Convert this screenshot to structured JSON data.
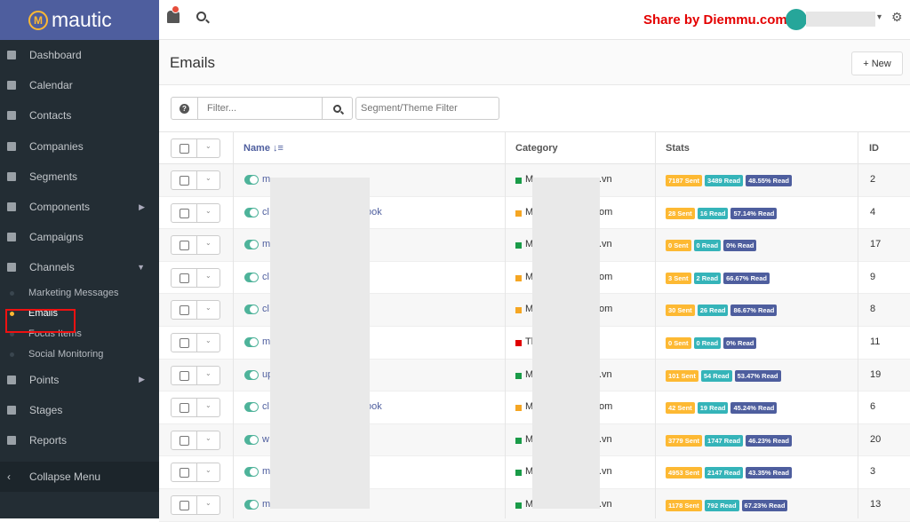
{
  "brand": {
    "name": "mautic",
    "mark": "M"
  },
  "topbar": {
    "share_text": "Share by Diemmu.com",
    "caret": "▾",
    "gear": "⚙"
  },
  "sidebar": {
    "items": [
      {
        "label": "Dashboard"
      },
      {
        "label": "Calendar"
      },
      {
        "label": "Contacts"
      },
      {
        "label": "Companies"
      },
      {
        "label": "Segments"
      },
      {
        "label": "Components",
        "arrow": "▶"
      },
      {
        "label": "Campaigns"
      },
      {
        "label": "Channels",
        "arrow": "▼"
      }
    ],
    "sub_items": [
      {
        "label": "Marketing Messages"
      },
      {
        "label": "Emails"
      },
      {
        "label": "Focus Items"
      },
      {
        "label": "Social Monitoring"
      }
    ],
    "items2": [
      {
        "label": "Points",
        "arrow": "▶"
      },
      {
        "label": "Stages"
      },
      {
        "label": "Reports"
      }
    ],
    "collapse": {
      "label": "Collapse Menu",
      "icon": "‹"
    }
  },
  "header": {
    "title": "Emails",
    "new_label": "+ New"
  },
  "filters": {
    "help_icon": "?",
    "filter_placeholder": "Filter...",
    "segment_placeholder": "Segment/Theme Filter"
  },
  "table": {
    "headers": {
      "name": "Name ↓≡",
      "category": "Category",
      "stats": "Stats",
      "id": "ID"
    },
    "caret": "⌄",
    "rows": [
      {
        "n1": "m",
        "n2": "",
        "c1": "M",
        "c2": ".vn",
        "color": "#1a9b48",
        "sent": "7187 Sent",
        "read": "3489 Read",
        "pct": "48.55% Read",
        "id": "2"
      },
      {
        "n1": "cl",
        "n2": "ook",
        "c1": "M",
        "c2": "om",
        "color": "#f5a623",
        "sent": "28 Sent",
        "read": "16 Read",
        "pct": "57.14% Read",
        "id": "4"
      },
      {
        "n1": "m",
        "n2": "",
        "c1": "M",
        "c2": ".vn",
        "color": "#1a9b48",
        "sent": "0 Sent",
        "read": "0 Read",
        "pct": "0% Read",
        "id": "17"
      },
      {
        "n1": "cl",
        "n2": "",
        "c1": "M",
        "c2": "om",
        "color": "#f5a623",
        "sent": "3 Sent",
        "read": "2 Read",
        "pct": "66.67% Read",
        "id": "9"
      },
      {
        "n1": "cl",
        "n2": "",
        "c1": "M",
        "c2": "om",
        "color": "#f5a623",
        "sent": "30 Sent",
        "read": "26 Read",
        "pct": "86.67% Read",
        "id": "8"
      },
      {
        "n1": "m",
        "n2": "",
        "c1": "Tl",
        "c2": "",
        "color": "#e00000",
        "sent": "0 Sent",
        "read": "0 Read",
        "pct": "0% Read",
        "id": "11"
      },
      {
        "n1": "up",
        "n2": "",
        "c1": "M",
        "c2": ".vn",
        "color": "#1a9b48",
        "sent": "101 Sent",
        "read": "54 Read",
        "pct": "53.47% Read",
        "id": "19"
      },
      {
        "n1": "cl",
        "n2": "ook",
        "c1": "M",
        "c2": "om",
        "color": "#f5a623",
        "sent": "42 Sent",
        "read": "19 Read",
        "pct": "45.24% Read",
        "id": "6"
      },
      {
        "n1": "w",
        "n2": "",
        "c1": "M",
        "c2": ".vn",
        "color": "#1a9b48",
        "sent": "3779 Sent",
        "read": "1747 Read",
        "pct": "46.23% Read",
        "id": "20"
      },
      {
        "n1": "m",
        "n2": "",
        "c1": "M",
        "c2": ".vn",
        "color": "#1a9b48",
        "sent": "4953 Sent",
        "read": "2147 Read",
        "pct": "43.35% Read",
        "id": "3"
      },
      {
        "n1": "m",
        "n2": "",
        "c1": "M",
        "c2": ".vn",
        "color": "#1a9b48",
        "sent": "1178 Sent",
        "read": "792 Read",
        "pct": "67.23% Read",
        "id": "13"
      }
    ]
  }
}
